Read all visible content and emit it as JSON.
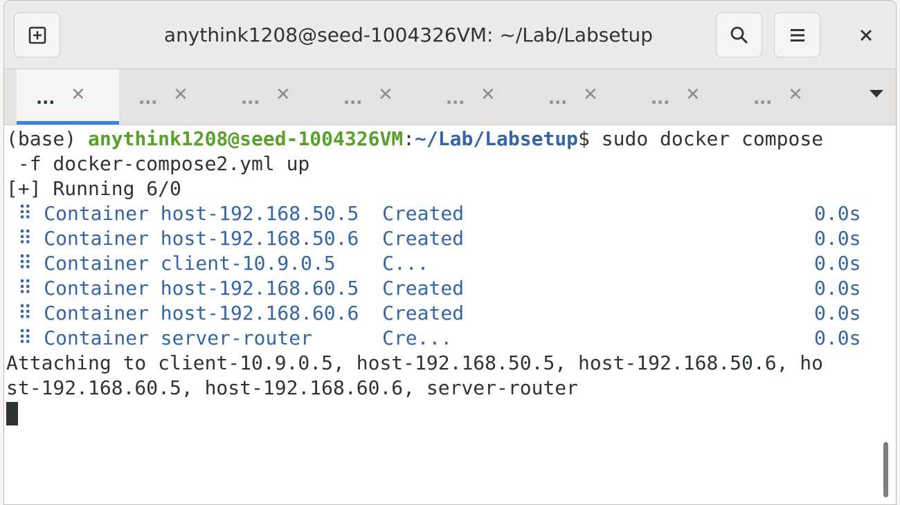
{
  "window": {
    "title": "anythink1208@seed-1004326VM: ~/Lab/Labsetup"
  },
  "icons": {
    "new_tab": "new-tab-icon",
    "search": "search-icon",
    "menu": "hamburger-menu-icon",
    "close": "close-icon"
  },
  "tabs": [
    {
      "label": "...",
      "active": true
    },
    {
      "label": "...",
      "active": false
    },
    {
      "label": "...",
      "active": false
    },
    {
      "label": "...",
      "active": false
    },
    {
      "label": "...",
      "active": false
    },
    {
      "label": "...",
      "active": false
    },
    {
      "label": "...",
      "active": false
    },
    {
      "label": "...",
      "active": false
    }
  ],
  "tab_close": "✕",
  "terminal": {
    "prompt_prefix": "(base) ",
    "prompt_user": "anythink1208@seed-1004326VM",
    "prompt_sep": ":",
    "prompt_path": "~/Lab/Labsetup",
    "prompt_end": "$ sudo docker compose",
    "command_cont": " -f docker-compose2.yml up",
    "running": "[+] Running 6/0",
    "containers": [
      {
        "name": " ⠿ Container host-192.168.50.5  Created",
        "time": "0.0s"
      },
      {
        "name": " ⠿ Container host-192.168.50.6  Created",
        "time": "0.0s"
      },
      {
        "name": " ⠿ Container client-10.9.0.5    C...",
        "time": "0.0s"
      },
      {
        "name": " ⠿ Container host-192.168.60.5  Created",
        "time": "0.0s"
      },
      {
        "name": " ⠿ Container host-192.168.60.6  Created",
        "time": "0.0s"
      },
      {
        "name": " ⠿ Container server-router      Cre...",
        "time": "0.0s"
      }
    ],
    "attach_line1": "Attaching to client-10.9.0.5, host-192.168.50.5, host-192.168.50.6, ho",
    "attach_line2": "st-192.168.60.5, host-192.168.60.6, server-router"
  },
  "colors": {
    "prompt_user": "#5aa02c",
    "prompt_path": "#3465a4",
    "active_tab_underline": "#3584e4"
  }
}
